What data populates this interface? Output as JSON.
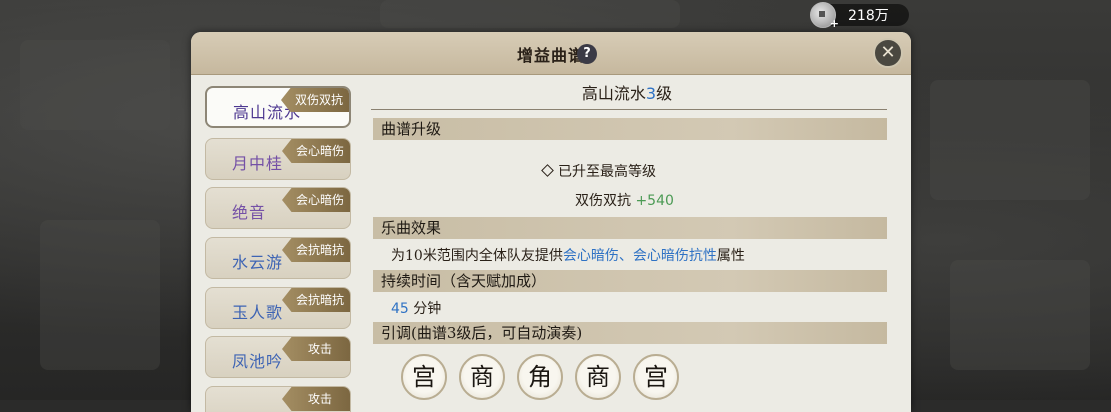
{
  "currency": {
    "value": "218万",
    "icon": "coin-plus-icon"
  },
  "dialog": {
    "title": "增益曲谱",
    "help_label": "?",
    "close_label": "✕"
  },
  "song_list": [
    {
      "name": "高山流水",
      "tag": "双伤双抗",
      "selected": true
    },
    {
      "name": "月中桂",
      "tag": "会心暗伤"
    },
    {
      "name": "绝音",
      "tag": "会心暗伤"
    },
    {
      "name": "水云游",
      "tag": "会抗暗抗"
    },
    {
      "name": "玉人歌",
      "tag": "会抗暗抗"
    },
    {
      "name": "凤池吟",
      "tag": "攻击"
    },
    {
      "name": "",
      "tag": "攻击"
    }
  ],
  "detail": {
    "song_name": "高山流水",
    "song_level": "3",
    "song_level_suffix": "级",
    "upgrade": {
      "heading": "曲谱升级",
      "status": "已升至最高等级",
      "bonus_label": "双伤双抗",
      "bonus_value": "+540"
    },
    "effect": {
      "heading": "乐曲效果",
      "prefix": "为10米范围内全体队友提供",
      "highlight": "会心暗伤、会心暗伤抗性",
      "suffix": "属性"
    },
    "duration": {
      "heading": "持续时间（含天赋加成）",
      "value": "45",
      "unit": "分钟"
    },
    "prelude": {
      "heading": "引调(曲谱3级后，可自动演奏)",
      "notes": [
        "宫",
        "商",
        "角",
        "商",
        "宫"
      ]
    }
  }
}
